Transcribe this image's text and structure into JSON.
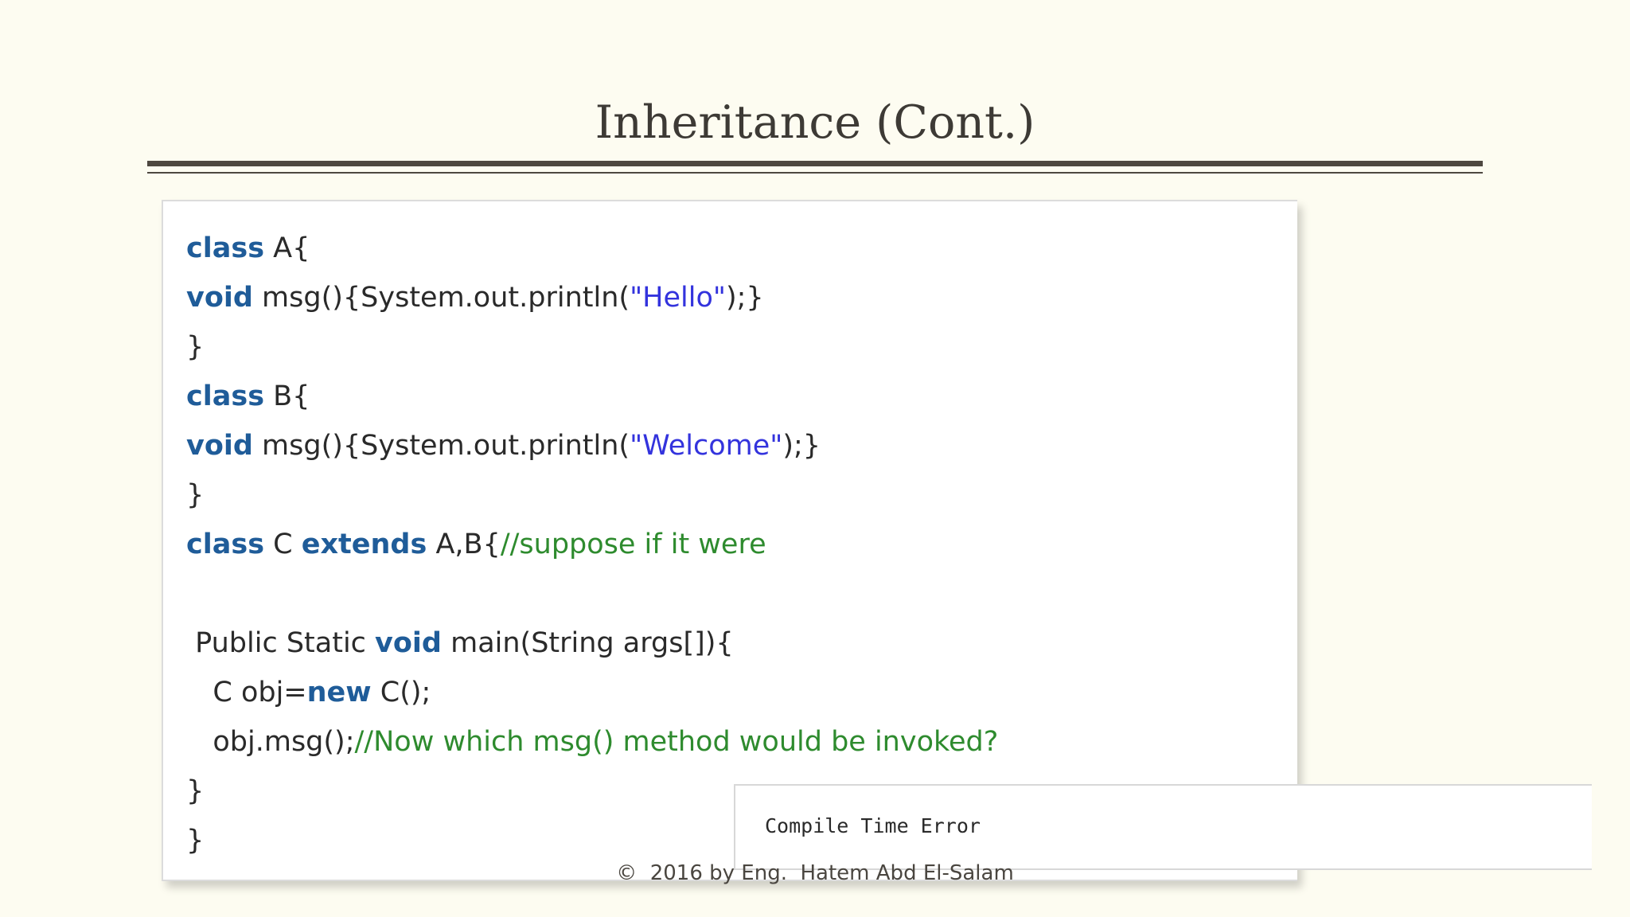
{
  "slide": {
    "title": "Inheritance (Cont.)",
    "footer": "©  2016 by Eng.  Hatem Abd El-Salam"
  },
  "code": {
    "l1_kw": "class",
    "l1_rest": " A{",
    "l2_kw": "void",
    "l2_a": " msg(){System.out.println(",
    "l2_str": "\"Hello\"",
    "l2_b": ");}",
    "l3": "}",
    "l4_kw": "class",
    "l4_rest": " B{",
    "l5_kw": "void",
    "l5_a": " msg(){System.out.println(",
    "l5_str": "\"Welcome\"",
    "l5_b": ");}",
    "l6": "}",
    "l7_kw1": "class",
    "l7_a": " C ",
    "l7_kw2": "extends",
    "l7_b": " A,B{",
    "l7_cmt": "//suppose if it were",
    "l8_a": " Public Static ",
    "l8_kw": "void",
    "l8_b": " main(String args[]){",
    "l9_a": "   C obj=",
    "l9_kw": "new",
    "l9_b": " C();",
    "l10_a": "   obj.msg();",
    "l10_cmt": "//Now which msg() method would be invoked?",
    "l11": "}",
    "l12": "}"
  },
  "result": {
    "text": "Compile Time Error"
  }
}
